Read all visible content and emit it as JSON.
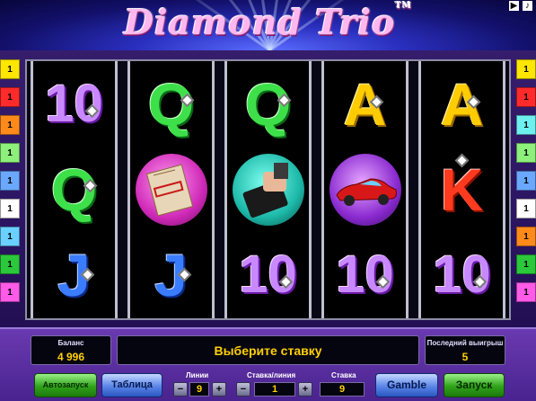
{
  "header": {
    "title": "Diamond Trio",
    "trademark": "TM",
    "icons": [
      "play-icon",
      "sound-icon"
    ]
  },
  "paylines": {
    "left": [
      {
        "n": "1",
        "color": "#ffe600"
      },
      {
        "n": "1",
        "color": "#ff2a2a"
      },
      {
        "n": "1",
        "color": "#ff8a1a"
      },
      {
        "n": "1",
        "color": "#8cf07a"
      },
      {
        "n": "1",
        "color": "#6aa8ff"
      },
      {
        "n": "1",
        "color": "#ffffff"
      },
      {
        "n": "1",
        "color": "#6ad0ff"
      },
      {
        "n": "1",
        "color": "#2ac83a"
      },
      {
        "n": "1",
        "color": "#ff5ae8"
      }
    ],
    "right": [
      {
        "n": "1",
        "color": "#ffe600"
      },
      {
        "n": "1",
        "color": "#ff2a2a"
      },
      {
        "n": "1",
        "color": "#6ff0f0"
      },
      {
        "n": "1",
        "color": "#8cf07a"
      },
      {
        "n": "1",
        "color": "#6aa8ff"
      },
      {
        "n": "1",
        "color": "#ffffff"
      },
      {
        "n": "1",
        "color": "#ff8a1a"
      },
      {
        "n": "1",
        "color": "#2ac83a"
      },
      {
        "n": "1",
        "color": "#ff5ae8"
      }
    ]
  },
  "reels": [
    [
      "10",
      "Q",
      "J"
    ],
    [
      "Q",
      "top-secret-folder",
      "J"
    ],
    [
      "Q",
      "spy-briefcase",
      "10"
    ],
    [
      "A",
      "red-sports-car",
      "10"
    ],
    [
      "A",
      "K",
      "10"
    ]
  ],
  "panel": {
    "balance_label": "Баланс",
    "balance_value": "4 996",
    "message": "Выберите ставку",
    "last_win_label": "Последний выигрыш",
    "last_win_value": "5",
    "autoplay_label": "Автозапуск",
    "table_label": "Таблица",
    "lines_label": "Линии",
    "lines_value": "9",
    "bet_per_line_label": "Ставка/линия",
    "bet_per_line_value": "1",
    "bet_label": "Ставка",
    "bet_value": "9",
    "gamble_label": "Gamble",
    "spin_label": "Запуск",
    "minus": "−",
    "plus": "+"
  }
}
